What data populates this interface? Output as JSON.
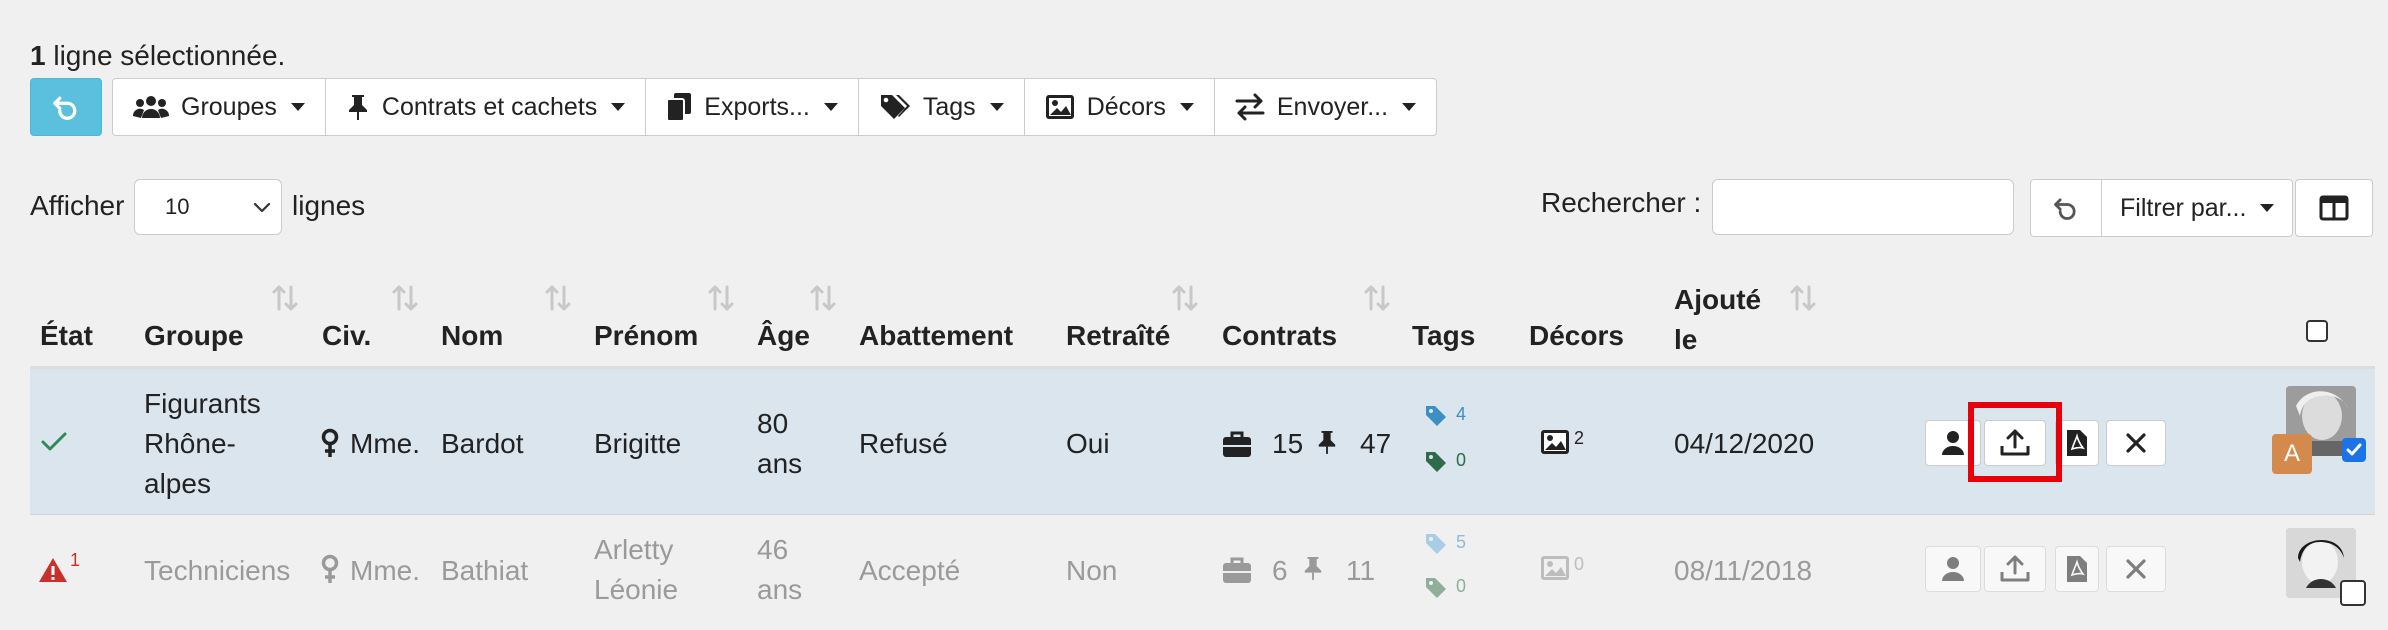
{
  "selection": {
    "count": "1",
    "text": "ligne sélectionnée."
  },
  "toolbar": {
    "groupes": "Groupes",
    "contrats": "Contrats et cachets",
    "exports": "Exports...",
    "tags": "Tags",
    "decors": "Décors",
    "envoyer": "Envoyer..."
  },
  "length": {
    "prefix": "Afficher",
    "value": "10",
    "suffix": "lignes"
  },
  "search": {
    "label": "Rechercher :",
    "value": "",
    "filter_label": "Filtrer par..."
  },
  "columns": {
    "etat": "État",
    "groupe": "Groupe",
    "civ": "Civ.",
    "nom": "Nom",
    "prenom": "Prénom",
    "age": "Âge",
    "abattement": "Abattement",
    "retraite": "Retraîté",
    "contrats": "Contrats",
    "tags": "Tags",
    "decors": "Décors",
    "ajoute_l1": "Ajouté",
    "ajoute_l2": "le"
  },
  "rows": [
    {
      "etat_badge": "",
      "groupe_l1": "Figurants",
      "groupe_l2": "Rhône-",
      "groupe_l3": "alpes",
      "civ": "Mme.",
      "nom": "Bardot",
      "prenom_l1": "Brigitte",
      "prenom_l2": "",
      "age_l1": "80",
      "age_l2": "ans",
      "abattement": "Refusé",
      "retraite": "Oui",
      "contrats": "15",
      "cachets": "47",
      "tags_blue": "4",
      "tags_green": "0",
      "decors": "2",
      "ajoute": "04/12/2020",
      "avatar_letter": "A",
      "selected": true
    },
    {
      "etat_badge": "1",
      "groupe_l1": "Techniciens",
      "civ": "Mme.",
      "nom": "Bathiat",
      "prenom_l1": "Arletty",
      "prenom_l2": "Léonie",
      "age_l1": "46",
      "age_l2": "ans",
      "abattement": "Accepté",
      "retraite": "Non",
      "contrats": "6",
      "cachets": "11",
      "tags_blue": "5",
      "tags_green": "0",
      "decors": "0",
      "ajoute": "08/11/2018",
      "selected": false
    }
  ],
  "colors": {
    "accent": "#5bc0de",
    "highlight": "#e8000b",
    "selected_row": "#dbe5ee",
    "tag_blue": "#3b8fc2",
    "tag_green": "#2e6b4a",
    "danger": "#c9302c",
    "success": "#2e8b57"
  }
}
